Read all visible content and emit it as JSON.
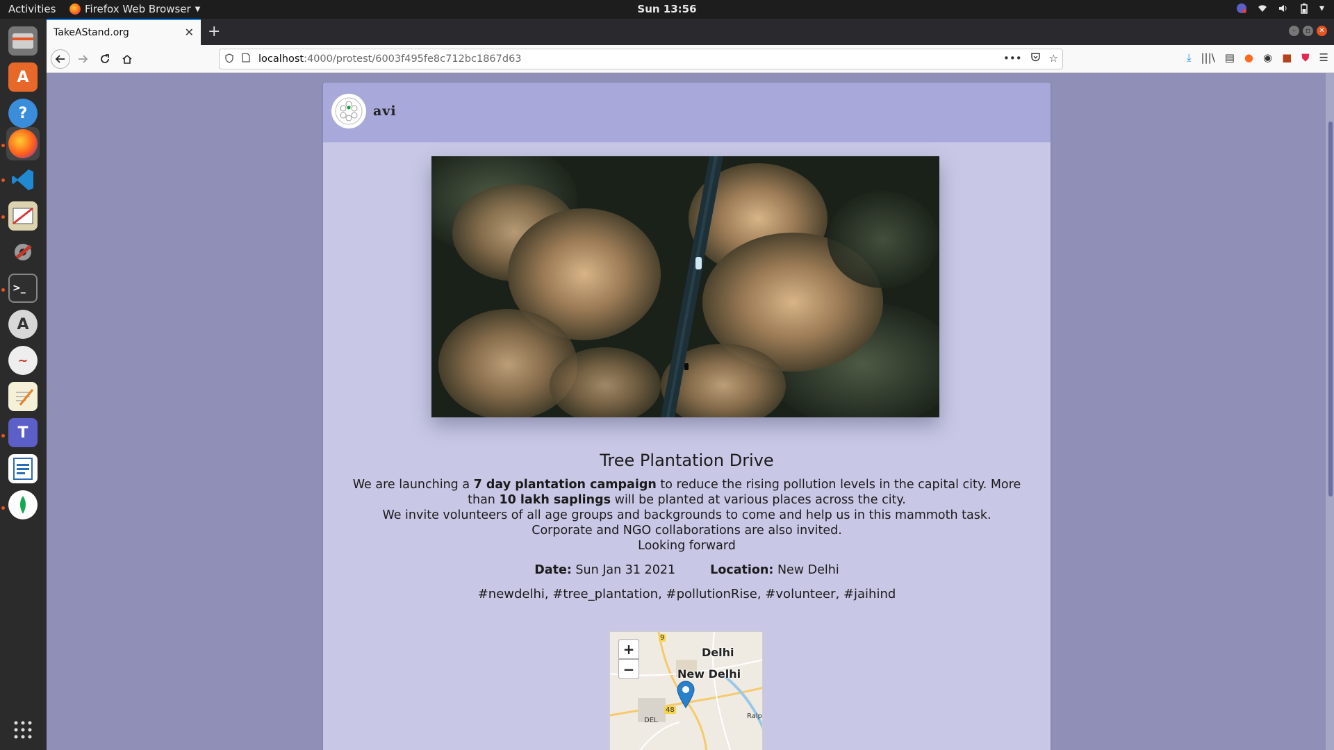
{
  "topbar": {
    "activities": "Activities",
    "app_name": "Firefox Web Browser",
    "clock": "Sun 13:56"
  },
  "dock": {
    "items": [
      "files-icon",
      "software-center-icon",
      "help-icon",
      "firefox-icon",
      "vscode-icon",
      "rabbitvcs-icon",
      "settings-tool-icon",
      "terminal-icon",
      "software-updater-icon",
      "screen-recorder-icon",
      "text-editor-icon",
      "teams-icon",
      "writer-icon",
      "mongodb-compass-icon",
      "show-apps-icon"
    ]
  },
  "browser": {
    "tab_title": "TakeAStand.org",
    "url_host": "localhost",
    "url_path": ":4000/protest/6003f495fe8c712bc1867d63"
  },
  "page": {
    "username": "avi",
    "title": "Tree Plantation Drive",
    "desc_1": "We are launching a ",
    "desc_bold_1": "7 day plantation campaign",
    "desc_2": " to reduce the rising pollution levels in the capital city. More than ",
    "desc_bold_2": "10 lakh saplings",
    "desc_3": " will be planted at various places across the city.",
    "desc_line_2": "We invite volunteers of all age groups and backgrounds to come and help us in this mammoth task.",
    "desc_line_3": "Corporate and NGO collaborations are also invited.",
    "desc_line_4": "Looking forward",
    "date_label": "Date:",
    "date_value": "Sun Jan 31 2021",
    "location_label": "Location:",
    "location_value": "New Delhi",
    "tags": "#newdelhi, #tree_plantation, #pollutionRise, #volunteer, #jaihind"
  },
  "map": {
    "zoom_in": "+",
    "zoom_out": "−",
    "label_delhi": "Delhi",
    "label_new_delhi": "New Delhi",
    "label_del": "DEL",
    "label_ralp": "Ralp",
    "road_9": "9",
    "road_48": "48"
  },
  "colors": {
    "page_bg": "#8f8fb8",
    "card_bg": "#c8c8e6",
    "card_header": "#a8a8da",
    "marker": "#2a81cb"
  }
}
